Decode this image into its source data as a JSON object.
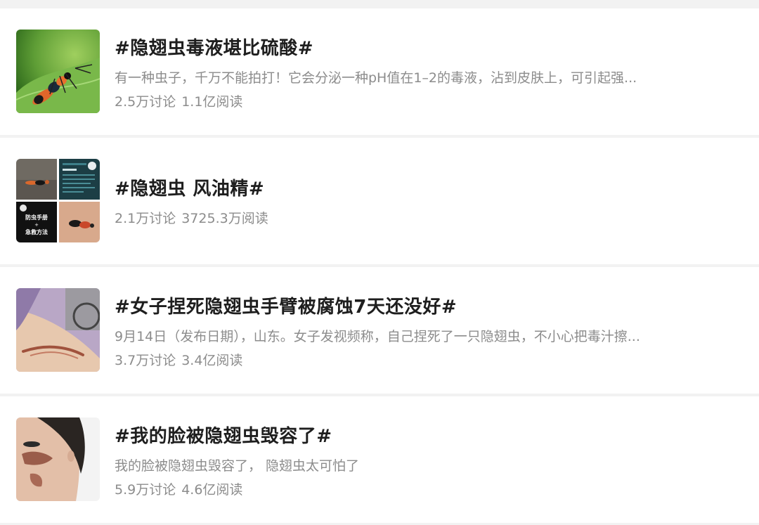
{
  "topics": [
    {
      "title": "#隐翅虫毒液堪比硫酸#",
      "description": "有一种虫子，千万不能拍打！它会分泌一种pH值在1–2的毒液，沾到皮肤上，可引起强...",
      "discussions": "2.5万讨论",
      "reads": "1.1亿阅读",
      "image": "rove-beetle-on-leaf-photo"
    },
    {
      "title": "#隐翅虫 风油精#",
      "discussions": "2.1万讨论",
      "reads": "3725.3万阅读",
      "image": "beetle-collage-photo",
      "collage_text": {
        "poster_line1": "防虫手册",
        "poster_line2": "+",
        "poster_line3": "急救方法"
      }
    },
    {
      "title": "#女子捏死隐翅虫手臂被腐蚀7天还没好#",
      "description": "9月14日（发布日期），山东。女子发视频称，自己捏死了一只隐翅虫，不小心把毒汁擦...",
      "discussions": "3.7万讨论",
      "reads": "3.4亿阅读",
      "image": "injured-arm-photo"
    },
    {
      "title": "#我的脸被隐翅虫毁容了#",
      "description": "我的脸被隐翅虫毁容了，  隐翅虫太可怕了",
      "discussions": "5.9万讨论",
      "reads": "4.6亿阅读",
      "image": "injured-face-photo"
    }
  ],
  "colors": {
    "background": "#f2f2f2",
    "card": "#ffffff",
    "title": "#1e1e1e",
    "secondary": "#8c8c8c"
  }
}
